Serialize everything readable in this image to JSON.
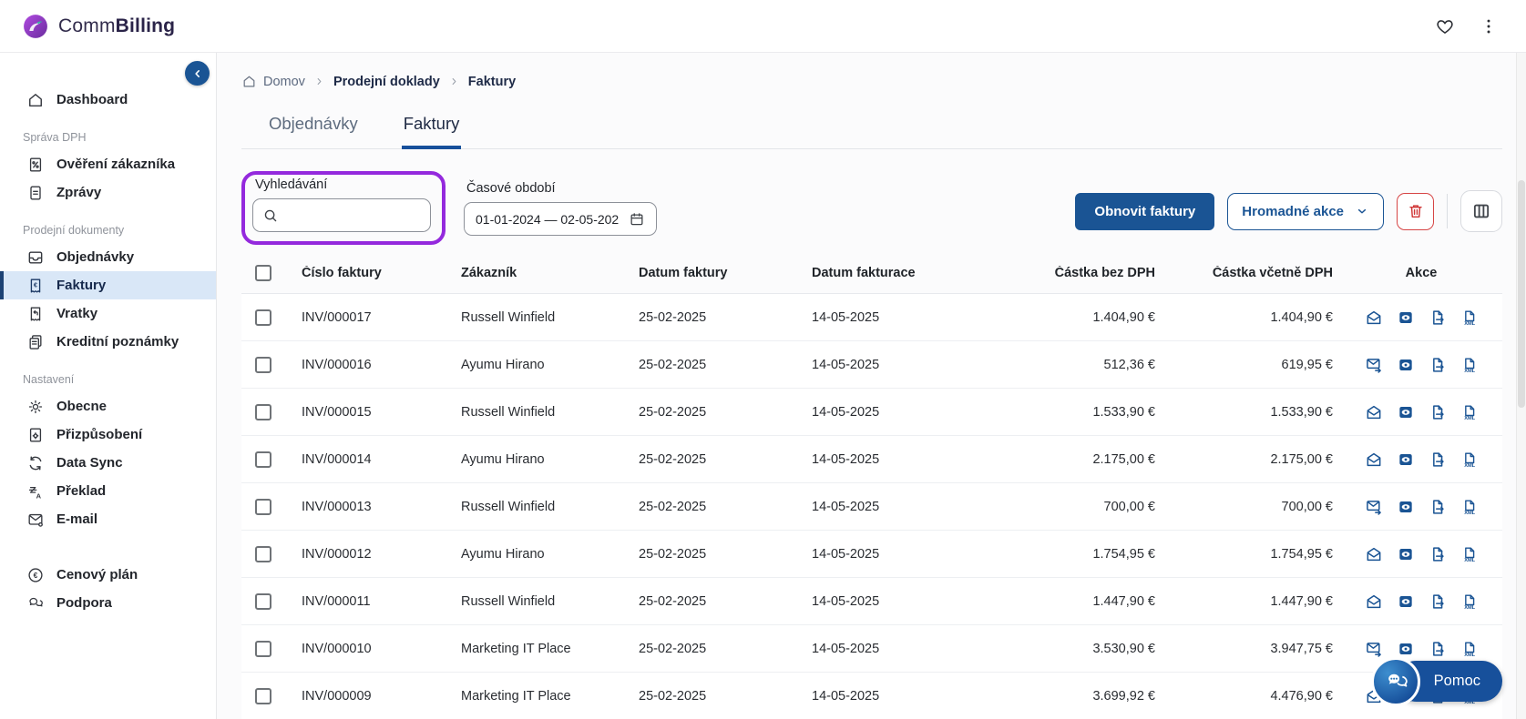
{
  "brand": {
    "name_regular": "Comm",
    "name_bold": "Billing"
  },
  "sidebar": {
    "sections": [
      {
        "label": "",
        "items": [
          {
            "label": "Dashboard",
            "icon": "home-icon",
            "active": false
          }
        ]
      },
      {
        "label": "Správa DPH",
        "items": [
          {
            "label": "Ověření zákazníka",
            "icon": "customer-check-icon",
            "active": false
          },
          {
            "label": "Zprávy",
            "icon": "reports-icon",
            "active": false
          }
        ]
      },
      {
        "label": "Prodejní dokumenty",
        "items": [
          {
            "label": "Objednávky",
            "icon": "orders-icon",
            "active": false
          },
          {
            "label": "Faktury",
            "icon": "invoices-icon",
            "active": true
          },
          {
            "label": "Vratky",
            "icon": "returns-icon",
            "active": false
          },
          {
            "label": "Kreditní poznámky",
            "icon": "credit-notes-icon",
            "active": false
          }
        ]
      },
      {
        "label": "Nastavení",
        "items": [
          {
            "label": "Obecne",
            "icon": "settings-gear-icon",
            "active": false
          },
          {
            "label": "Přizpůsobení",
            "icon": "customization-icon",
            "active": false
          },
          {
            "label": "Data Sync",
            "icon": "sync-icon",
            "active": false
          },
          {
            "label": "Překlad",
            "icon": "translate-icon",
            "active": false
          },
          {
            "label": "E-mail",
            "icon": "email-settings-icon",
            "active": false
          }
        ]
      },
      {
        "label": "",
        "items": [
          {
            "label": "Cenový plán",
            "icon": "pricing-plan-icon",
            "active": false
          },
          {
            "label": "Podpora",
            "icon": "support-icon",
            "active": false
          }
        ]
      }
    ]
  },
  "breadcrumb": {
    "items": [
      {
        "label": "Domov"
      },
      {
        "label": "Prodejní doklady"
      },
      {
        "label": "Faktury"
      }
    ]
  },
  "tabs": [
    {
      "label": "Objednávky",
      "active": false
    },
    {
      "label": "Faktury",
      "active": true
    }
  ],
  "filters": {
    "search": {
      "label": "Vyhledávání",
      "value": "",
      "placeholder": ""
    },
    "period": {
      "label": "Časové období",
      "value": "01-01-2024 — 02-05-202"
    }
  },
  "toolbar": {
    "refresh_button": "Obnovit faktury",
    "bulk_button": "Hromadné akce"
  },
  "table": {
    "columns": [
      "Číslo faktury",
      "Zákazník",
      "Datum faktury",
      "Datum fakturace",
      "Částka bez DPH",
      "Částka včetně DPH",
      "Akce"
    ],
    "rows": [
      {
        "invoice_no": "INV/000017",
        "customer": "Russell Winfield",
        "invoice_date": "25-02-2025",
        "billing_date": "14-05-2025",
        "amount_net": "1.404,90 €",
        "amount_gross": "1.404,90 €",
        "email_action": "open"
      },
      {
        "invoice_no": "INV/000016",
        "customer": "Ayumu Hirano",
        "invoice_date": "25-02-2025",
        "billing_date": "14-05-2025",
        "amount_net": "512,36 €",
        "amount_gross": "619,95 €",
        "email_action": "send"
      },
      {
        "invoice_no": "INV/000015",
        "customer": "Russell Winfield",
        "invoice_date": "25-02-2025",
        "billing_date": "14-05-2025",
        "amount_net": "1.533,90 €",
        "amount_gross": "1.533,90 €",
        "email_action": "open"
      },
      {
        "invoice_no": "INV/000014",
        "customer": "Ayumu Hirano",
        "invoice_date": "25-02-2025",
        "billing_date": "14-05-2025",
        "amount_net": "2.175,00 €",
        "amount_gross": "2.175,00 €",
        "email_action": "open"
      },
      {
        "invoice_no": "INV/000013",
        "customer": "Russell Winfield",
        "invoice_date": "25-02-2025",
        "billing_date": "14-05-2025",
        "amount_net": "700,00 €",
        "amount_gross": "700,00 €",
        "email_action": "send"
      },
      {
        "invoice_no": "INV/000012",
        "customer": "Ayumu Hirano",
        "invoice_date": "25-02-2025",
        "billing_date": "14-05-2025",
        "amount_net": "1.754,95 €",
        "amount_gross": "1.754,95 €",
        "email_action": "open"
      },
      {
        "invoice_no": "INV/000011",
        "customer": "Russell Winfield",
        "invoice_date": "25-02-2025",
        "billing_date": "14-05-2025",
        "amount_net": "1.447,90 €",
        "amount_gross": "1.447,90 €",
        "email_action": "open"
      },
      {
        "invoice_no": "INV/000010",
        "customer": "Marketing IT Place",
        "invoice_date": "25-02-2025",
        "billing_date": "14-05-2025",
        "amount_net": "3.530,90 €",
        "amount_gross": "3.947,75 €",
        "email_action": "send"
      },
      {
        "invoice_no": "INV/000009",
        "customer": "Marketing IT Place",
        "invoice_date": "25-02-2025",
        "billing_date": "14-05-2025",
        "amount_net": "3.699,92 €",
        "amount_gross": "4.476,90 €",
        "email_action": "open"
      }
    ]
  },
  "help_button": {
    "label": "Pomoc"
  },
  "colors": {
    "primary_blue": "#1a5494",
    "active_tab_underline": "#17509b",
    "active_item_bg": "#d9e7f7",
    "danger_red": "#d64545",
    "highlight_purple": "#9429dd"
  }
}
